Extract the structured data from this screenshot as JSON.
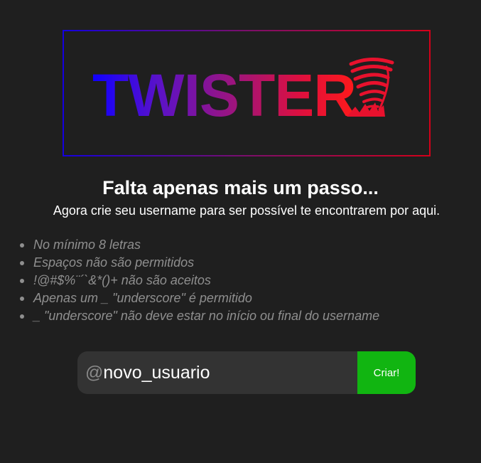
{
  "logo": {
    "text": "TWISTER",
    "icon": "tornado-icon",
    "colors": {
      "gradient_start": "#1000ff",
      "gradient_mid": "#a0147a",
      "gradient_end": "#ff1a1a",
      "icon_color": "#e8112d"
    }
  },
  "heading": {
    "title": "Falta apenas mais um passo...",
    "subtitle": "Agora crie seu username para ser possível te encontrarem por aqui."
  },
  "rules": [
    "No mínimo 8 letras",
    "Espaços não são permitidos",
    "!@#$%¨´`&*()+ não são aceitos",
    "Apenas um _ \"underscore\" é permitido",
    "_ \"underscore\" não deve estar no início ou final do username"
  ],
  "form": {
    "prefix": "@",
    "username_value": "novo_usuario",
    "submit_label": "Criar!"
  },
  "colors": {
    "background": "#1f1f1f",
    "input_background": "#333333",
    "button": "#11b511",
    "rule_text": "#8f8f8f"
  }
}
